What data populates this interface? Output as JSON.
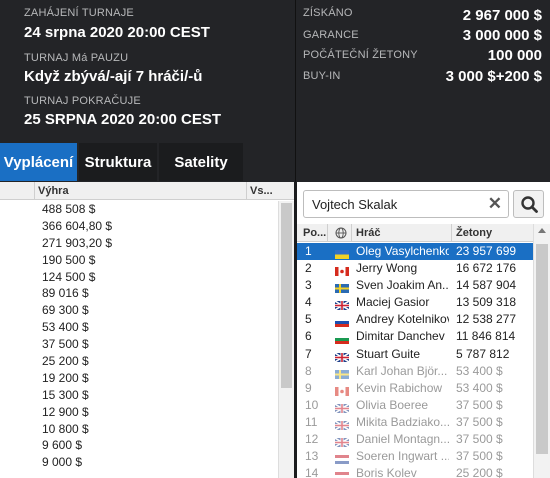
{
  "header": {
    "start_label": "ZAHÁJENÍ TURNAJE",
    "start_value": "24 srpna 2020  20:00 CEST",
    "pause_label": "TURNAJ Má PAUZU",
    "pause_value": "Když zbývá/-ají 7 hráči/-ů",
    "resume_label": "TURNAJ POKRAČUJE",
    "resume_value": "25 SRPNA 2020  20:00 CEST",
    "stats": [
      {
        "label": "ZÍSKÁNO",
        "value": "2 967 000 $"
      },
      {
        "label": "GARANCE",
        "value": "3 000 000 $"
      },
      {
        "label": "POČÁTEČNÍ ŽETONY",
        "value": "100 000"
      },
      {
        "label": "BUY-IN",
        "value": "3 000 $+200 $"
      }
    ]
  },
  "tabs": [
    {
      "label": "Vyplácení",
      "active": true
    },
    {
      "label": "Struktura",
      "active": false
    },
    {
      "label": "Satelity",
      "active": false
    }
  ],
  "payouts": {
    "col_prize": "Výhra",
    "col_vs": "Vs...",
    "rows": [
      "488 508 $",
      "366 604,80 $",
      "271 903,20 $",
      "190 500 $",
      "124 500 $",
      "89 016 $",
      "69 300 $",
      "53 400 $",
      "37 500 $",
      "25 200 $",
      "19 200 $",
      "15 300 $",
      "12 900 $",
      "10 800 $",
      "9 600 $",
      "9 000 $"
    ]
  },
  "players": {
    "search_value": "Vojtech Skalak",
    "clear_icon": "close-icon",
    "search_icon": "search-icon",
    "col_pos": "Po...",
    "col_player": "Hráč",
    "col_chips": "Žetony",
    "rows": [
      {
        "pos": "1",
        "flag": "ukraine",
        "name": "Oleg Vasylchenko",
        "chips": "23 957 699",
        "selected": true,
        "eliminated": false
      },
      {
        "pos": "2",
        "flag": "canada",
        "name": "Jerry Wong",
        "chips": "16 672 176",
        "selected": false,
        "eliminated": false
      },
      {
        "pos": "3",
        "flag": "sweden",
        "name": "Sven Joakim An...",
        "chips": "14 587 904",
        "selected": false,
        "eliminated": false
      },
      {
        "pos": "4",
        "flag": "uk",
        "name": "Maciej Gasior",
        "chips": "13 509 318",
        "selected": false,
        "eliminated": false
      },
      {
        "pos": "5",
        "flag": "russia",
        "name": "Andrey Kotelnikov",
        "chips": "12 538 277",
        "selected": false,
        "eliminated": false
      },
      {
        "pos": "6",
        "flag": "bulgaria",
        "name": "Dimitar Danchev",
        "chips": "11 846 814",
        "selected": false,
        "eliminated": false
      },
      {
        "pos": "7",
        "flag": "uk",
        "name": "Stuart Guite",
        "chips": "5 787 812",
        "selected": false,
        "eliminated": false
      },
      {
        "pos": "8",
        "flag": "sweden",
        "name": "Karl Johan Björ...",
        "chips": "53 400 $",
        "selected": false,
        "eliminated": true
      },
      {
        "pos": "9",
        "flag": "canada",
        "name": "Kevin Rabichow",
        "chips": "53 400 $",
        "selected": false,
        "eliminated": true
      },
      {
        "pos": "10",
        "flag": "uk",
        "name": "Olivia Boeree",
        "chips": "37 500 $",
        "selected": false,
        "eliminated": true
      },
      {
        "pos": "11",
        "flag": "uk",
        "name": "Mikita Badziako...",
        "chips": "37 500 $",
        "selected": false,
        "eliminated": true
      },
      {
        "pos": "12",
        "flag": "uk",
        "name": "Daniel Montagn...",
        "chips": "37 500 $",
        "selected": false,
        "eliminated": true
      },
      {
        "pos": "13",
        "flag": "netherlands",
        "name": "Soeren Ingwart ...",
        "chips": "37 500 $",
        "selected": false,
        "eliminated": true
      },
      {
        "pos": "14",
        "flag": "netherlands",
        "name": "Boris Kolev",
        "chips": "25 200 $",
        "selected": false,
        "eliminated": true
      }
    ]
  },
  "colors": {
    "accent": "#1a6fc4",
    "header_bg": "#232427"
  }
}
